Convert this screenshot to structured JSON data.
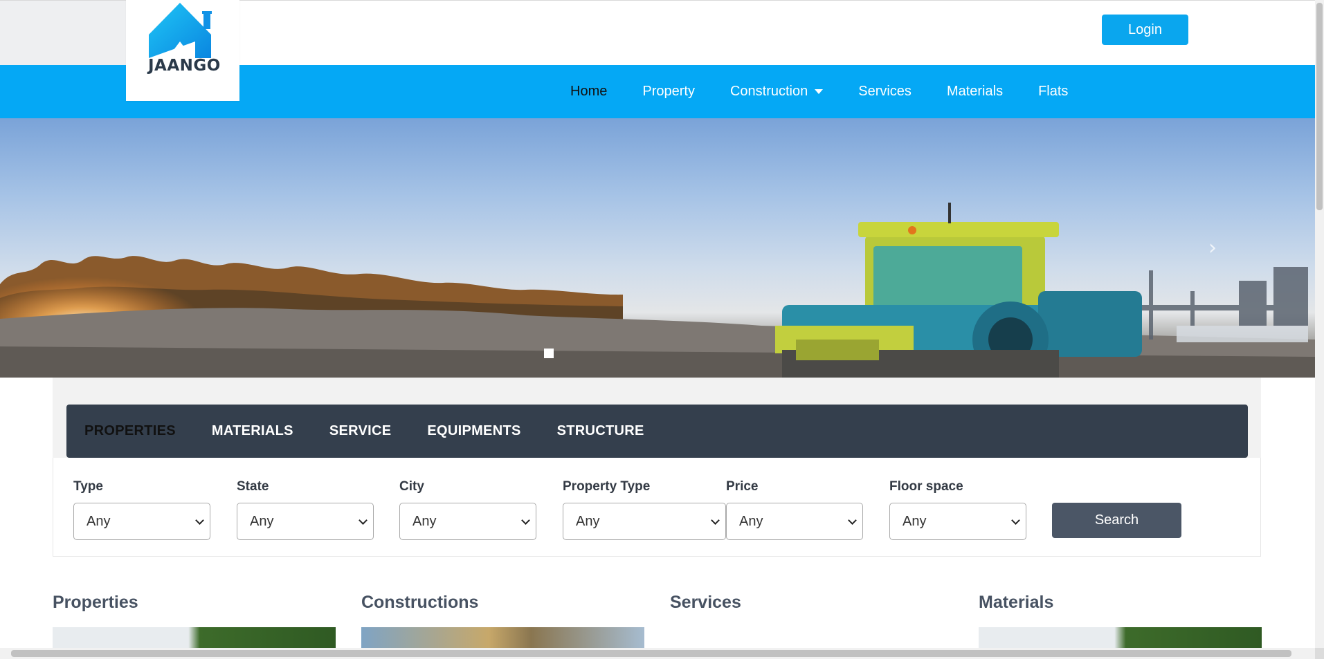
{
  "brand": {
    "logo_text": "JAANGO",
    "accent": "#05a8f5"
  },
  "header": {
    "login_label": "Login"
  },
  "nav": {
    "items": [
      {
        "label": "Home",
        "active": true
      },
      {
        "label": "Property"
      },
      {
        "label": "Construction",
        "dropdown": true
      },
      {
        "label": "Services"
      },
      {
        "label": "Materials"
      },
      {
        "label": "Flats"
      }
    ]
  },
  "hero": {
    "next_icon": "chevron-right-icon",
    "next_glyph": "›",
    "slides": 1
  },
  "search": {
    "tabs": [
      {
        "label": "PROPERTIES",
        "active": true
      },
      {
        "label": "MATERIALS"
      },
      {
        "label": "SERVICE"
      },
      {
        "label": "EQUIPMENTS"
      },
      {
        "label": "STRUCTURE"
      }
    ],
    "fields": [
      {
        "label": "Type",
        "value": "Any"
      },
      {
        "label": "State",
        "value": "Any"
      },
      {
        "label": "City",
        "value": "Any"
      },
      {
        "label": "Property Type",
        "value": "Any"
      },
      {
        "label": "Price",
        "value": "Any"
      },
      {
        "label": "Floor space",
        "value": "Any"
      }
    ],
    "button_label": "Search"
  },
  "categories": [
    {
      "title": "Properties"
    },
    {
      "title": "Constructions"
    },
    {
      "title": "Services"
    },
    {
      "title": "Materials"
    }
  ]
}
